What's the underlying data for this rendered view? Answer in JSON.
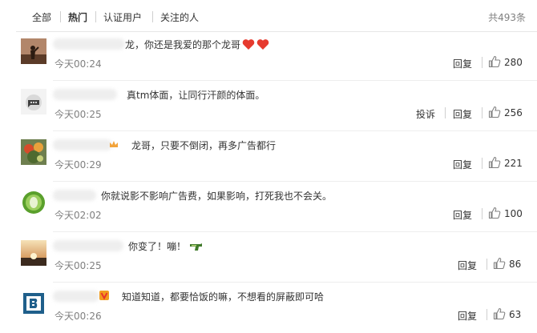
{
  "tabs": [
    "全部",
    "热门",
    "认证用户",
    "关注的人"
  ],
  "total": "共493条",
  "actions": {
    "reply": "回复",
    "report": "投诉"
  },
  "comments": [
    {
      "text": "龙，你还是我爱的那个龙哥",
      "time": "今天00:24",
      "likes": "280",
      "icons": [
        "heart",
        "heart"
      ]
    },
    {
      "text": "真tm体面，让同行汗颜的体面。",
      "time": "今天00:25",
      "likes": "256"
    },
    {
      "text": "龙哥，只要不倒闭，再多广告都行",
      "time": "今天00:29",
      "likes": "221"
    },
    {
      "text": "你就说影不影响广告费，如果影响，打死我也不会关。",
      "time": "今天02:02",
      "likes": "100"
    },
    {
      "text": "你变了！嘣！",
      "time": "今天00:25",
      "likes": "86",
      "icons": [
        "gun"
      ]
    },
    {
      "text": "知道知道，都要恰饭的嘛，不想看的屏蔽即可哈",
      "time": "今天00:26",
      "likes": "63"
    }
  ]
}
